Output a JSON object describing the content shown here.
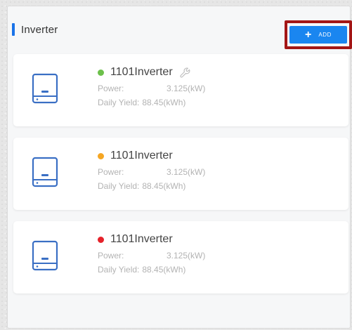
{
  "section": {
    "title": "Inverter",
    "accent_color": "#1a73e8"
  },
  "add_button": {
    "plus": "+",
    "label": "ADD",
    "color": "#1a86f0",
    "highlight_color": "#a31616"
  },
  "inverters": [
    {
      "name": "1101Inverter",
      "status_color": "#6cc04a",
      "show_wrench": true,
      "power_label": "Power:",
      "power_value": "3.125(kW)",
      "yield_label": "Daily Yield:",
      "yield_value": "88.45(kWh)"
    },
    {
      "name": "1101Inverter",
      "status_color": "#f5a623",
      "show_wrench": false,
      "power_label": "Power:",
      "power_value": "3.125(kW)",
      "yield_label": "Daily Yield:",
      "yield_value": "88.45(kWh)"
    },
    {
      "name": "1101Inverter",
      "status_color": "#e5222a",
      "show_wrench": false,
      "power_label": "Power:",
      "power_value": "3.125(kW)",
      "yield_label": "Daily Yield:",
      "yield_value": "88.45(kWh)"
    }
  ],
  "icons": {
    "device": "inverter-device-icon",
    "settings": "wrench-icon"
  }
}
